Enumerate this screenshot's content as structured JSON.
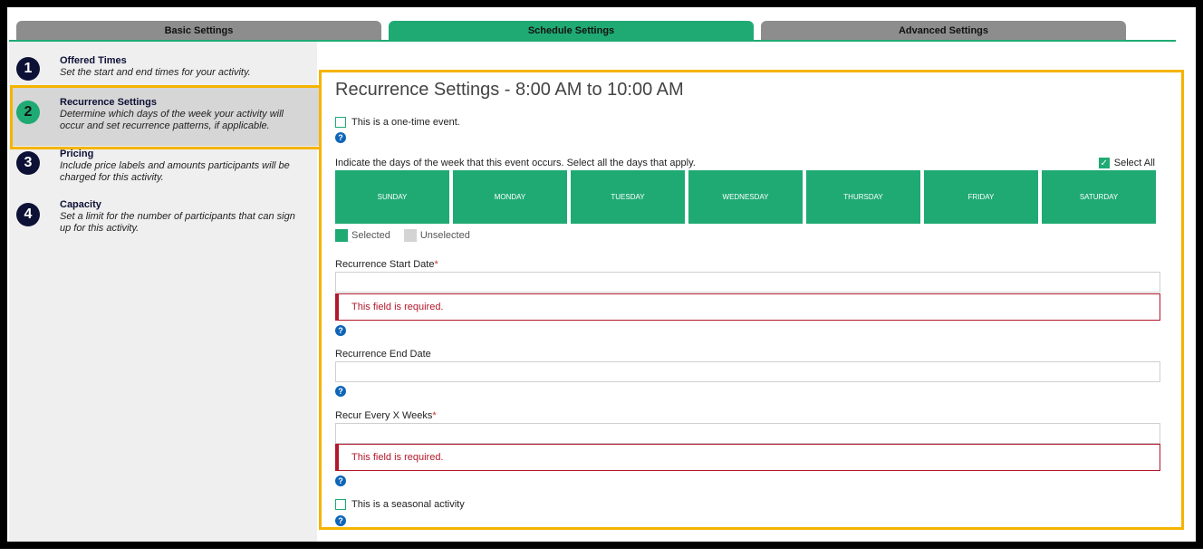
{
  "tabs": [
    {
      "label": "Basic Settings",
      "active": false
    },
    {
      "label": "Schedule Settings",
      "active": true
    },
    {
      "label": "Advanced Settings",
      "active": false
    }
  ],
  "steps": [
    {
      "number": "1",
      "title": "Offered Times",
      "description": "Set the start and end times for your activity."
    },
    {
      "number": "2",
      "title": "Recurrence Settings",
      "description": "Determine which days of the week your activity will occur and set recurrence patterns, if applicable."
    },
    {
      "number": "3",
      "title": "Pricing",
      "description": "Include price labels and amounts participants will be charged for this activity."
    },
    {
      "number": "4",
      "title": "Capacity",
      "description": "Set a limit for the number of participants that can sign up for this activity."
    }
  ],
  "main": {
    "heading": "Recurrence Settings - 8:00 AM to 10:00 AM",
    "one_time_label": "This is a one-time event.",
    "days_instruction": "Indicate the days of the week that this event occurs. Select all the days that apply.",
    "select_all_label": "Select All",
    "days": [
      "SUNDAY",
      "MONDAY",
      "TUESDAY",
      "WEDNESDAY",
      "THURSDAY",
      "FRIDAY",
      "SATURDAY"
    ],
    "legend_selected": "Selected",
    "legend_unselected": "Unselected",
    "start_date_label": "Recurrence Start Date",
    "end_date_label": "Recurrence End Date",
    "recur_weeks_label": "Recur Every X Weeks",
    "required_mark": "*",
    "error_text": "This field is required.",
    "seasonal_label": "This is a seasonal activity",
    "help_glyph": "?"
  },
  "colors": {
    "accent": "#1faa74",
    "highlight": "#f4b400",
    "step_dark": "#0d1136",
    "error": "#b2182b",
    "help": "#0e65b8"
  }
}
